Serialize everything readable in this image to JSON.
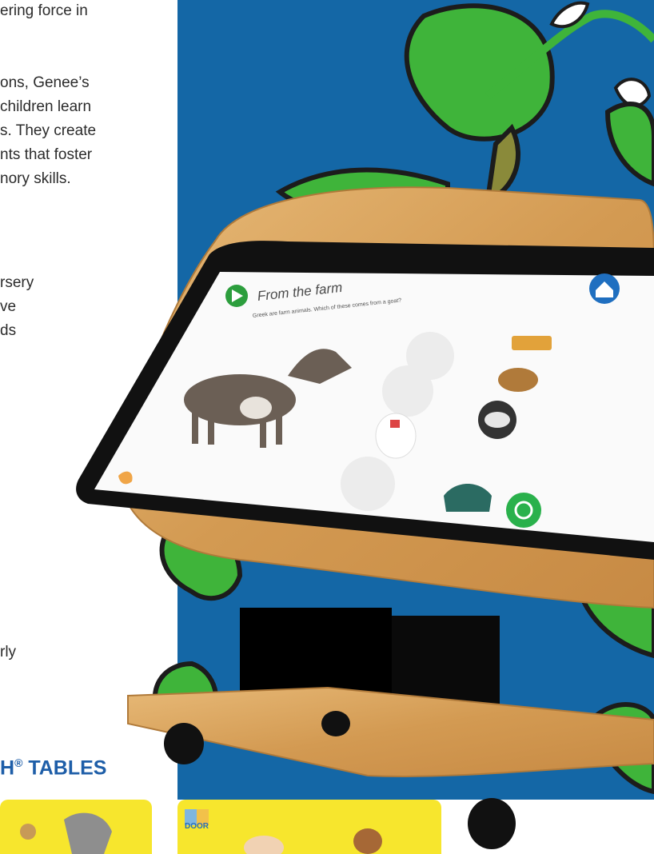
{
  "body_text": [
    "ering force in",
    "ons, Genee’s",
    "children learn",
    "s. They create",
    "nts that foster",
    "nory skills.",
    "rsery",
    "ve",
    "ds",
    "rly"
  ],
  "heading": {
    "main": "H",
    "reg": "®",
    "rest": " TABLES"
  },
  "screen": {
    "title": "From the farm",
    "question": "Greek are farm animals. Which of these comes from a goat?"
  },
  "card": {
    "door_label": "DOOR"
  },
  "colors": {
    "background_blue": "#1467a6",
    "heading_blue": "#1e5ea8",
    "card_yellow": "#f7e62d",
    "leaf_green": "#3fb43a"
  }
}
